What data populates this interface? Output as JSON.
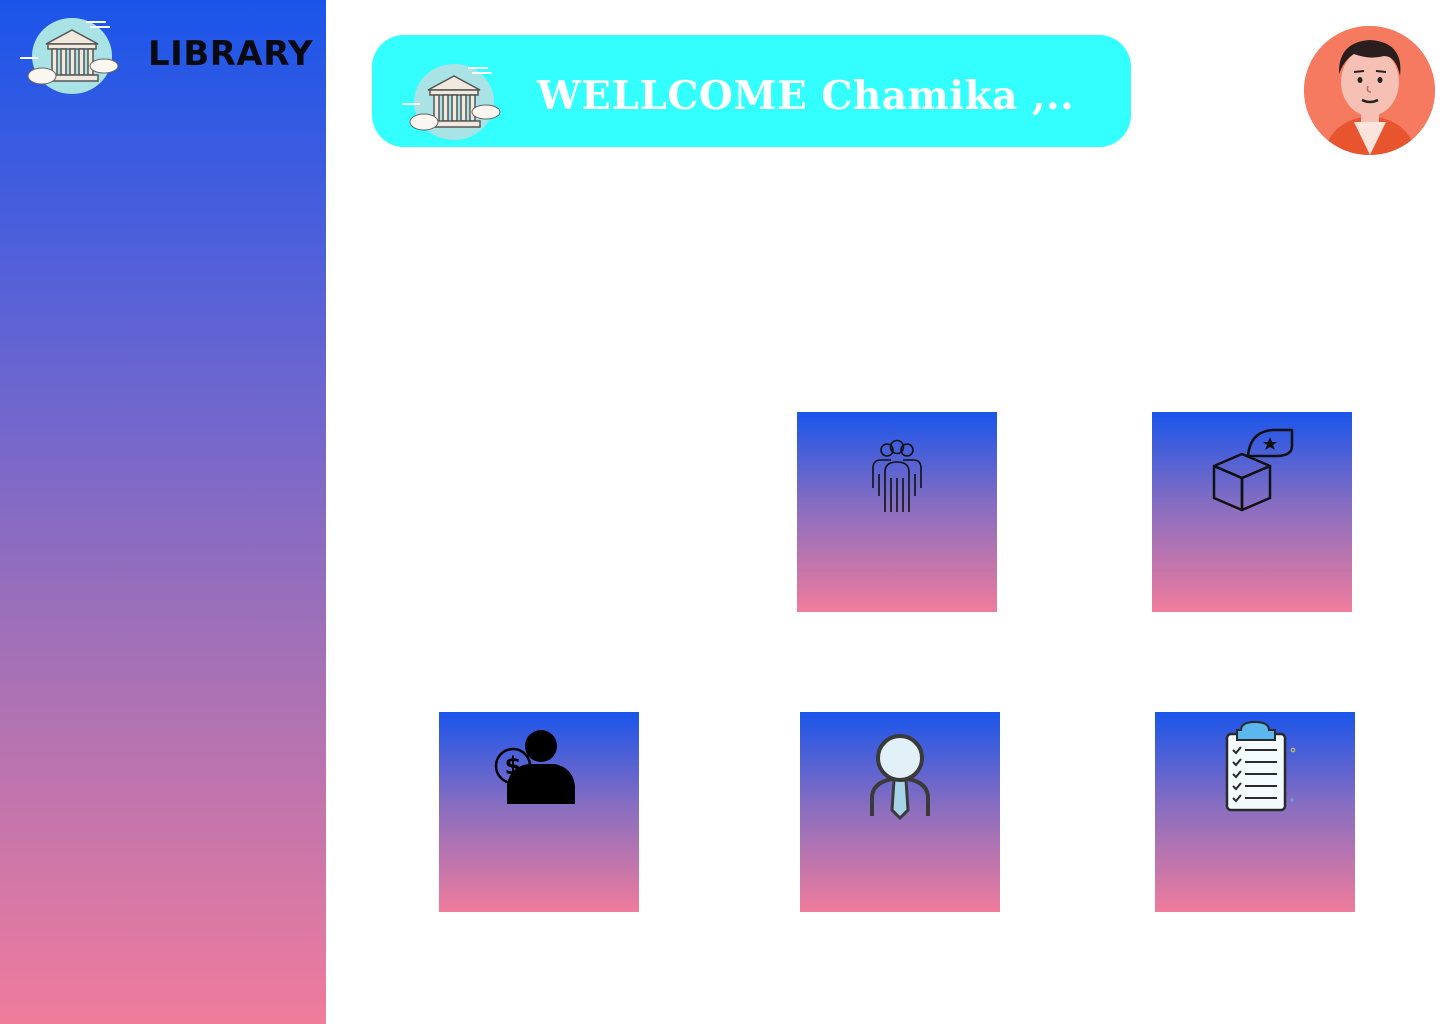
{
  "sidebar": {
    "brand_name": "LIBRARY",
    "logo_icon": "library-building-icon"
  },
  "header": {
    "welcome_text": "WELLCOME Chamika ,..",
    "banner_icon": "library-building-icon"
  },
  "user": {
    "avatar_icon": "user-avatar"
  },
  "tiles": [
    {
      "id": "members",
      "icon": "group-people-icon"
    },
    {
      "id": "books",
      "icon": "box-star-icon"
    },
    {
      "id": "payments",
      "icon": "user-dollar-icon"
    },
    {
      "id": "staff",
      "icon": "employee-tie-icon"
    },
    {
      "id": "reports",
      "icon": "clipboard-checklist-icon"
    }
  ],
  "colors": {
    "sidebar_top": "#1a55ea",
    "sidebar_bottom": "#f07c9c",
    "banner": "#33ffff",
    "avatar_bg": "#f57a60"
  }
}
